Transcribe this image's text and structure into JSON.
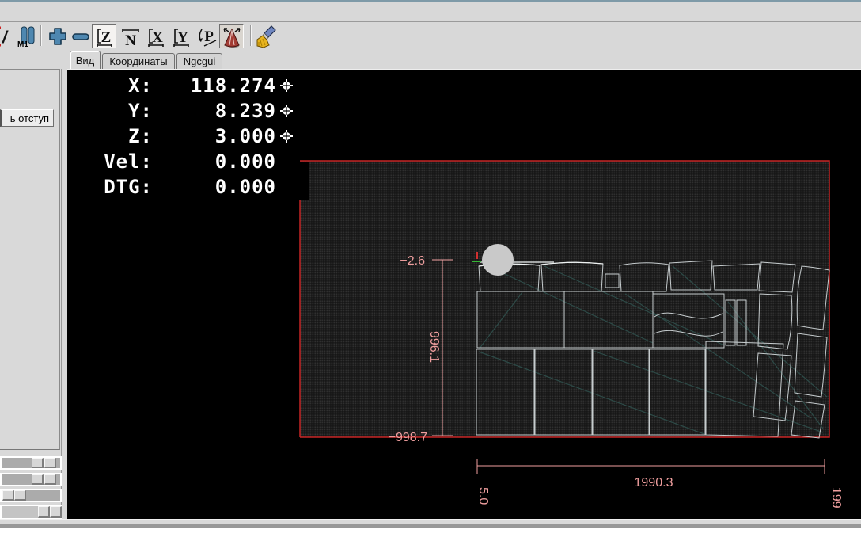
{
  "toolbar": {
    "icons": [
      {
        "name": "block-delete",
        "label": "/"
      },
      {
        "name": "optional-stop",
        "label": "M1"
      },
      {
        "name": "zoom-in"
      },
      {
        "name": "zoom-out"
      },
      {
        "name": "view-z",
        "label": "Z",
        "active": true
      },
      {
        "name": "view-z-rotated",
        "label": "N",
        "active": false
      },
      {
        "name": "view-x",
        "label": "X",
        "active": false
      },
      {
        "name": "view-y",
        "label": "Y",
        "active": false
      },
      {
        "name": "view-perspective",
        "label": "P",
        "active": false
      },
      {
        "name": "rotate-view",
        "active": true
      },
      {
        "name": "clear-plot"
      }
    ]
  },
  "tabs": [
    {
      "label": "Вид",
      "active": true
    },
    {
      "label": "Координаты",
      "active": false
    },
    {
      "label": "Ngcgui",
      "active": false
    }
  ],
  "sidebar": {
    "offset_button_label": "ь отступ"
  },
  "dro": {
    "rows": [
      {
        "label": "X:",
        "value": "118.274",
        "homed": true
      },
      {
        "label": "Y:",
        "value": "8.239",
        "homed": true
      },
      {
        "label": "Z:",
        "value": "3.000",
        "homed": true
      },
      {
        "label": "Vel:",
        "value": "0.000",
        "homed": false
      },
      {
        "label": "DTG:",
        "value": "0.000",
        "homed": false
      }
    ]
  },
  "preview": {
    "dimensions": {
      "y_top": "−2.6",
      "y_extent": "996.1",
      "y_bottom": "−998.7",
      "x_extent": "1990.3",
      "x_left": "5.0",
      "x_right": "199"
    }
  },
  "colors": {
    "dimension_text": "#ef9e9e",
    "machine_limit": "#c62424",
    "part_outline": "#c6ccce",
    "rapid_move": "#2d4a47",
    "tool": "#c9c9c9",
    "accent_blue": "#4e87b0"
  }
}
